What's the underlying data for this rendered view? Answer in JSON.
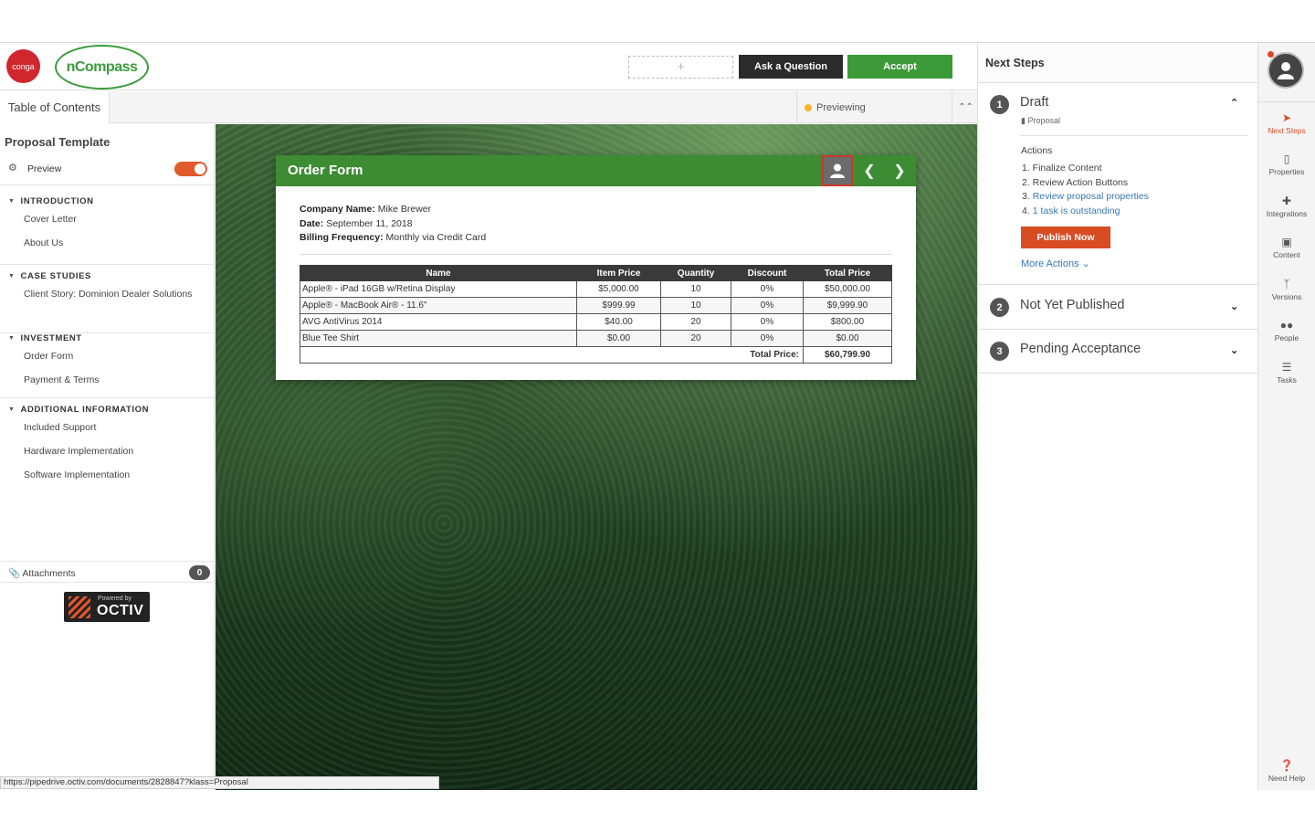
{
  "header": {
    "conga_logo": "conga",
    "ncompass_logo": "nCompass",
    "add_slot": "+",
    "ask_label": "Ask a Question",
    "accept_label": "Accept"
  },
  "subbar": {
    "toc_tab": "Table of Contents",
    "status": "Previewing",
    "status_color": "#f5b728"
  },
  "sidebar": {
    "title": "Proposal Template",
    "preview_label": "Preview",
    "preview_on": true,
    "sections": [
      {
        "title": "INTRODUCTION",
        "items": [
          "Cover Letter",
          "About Us"
        ]
      },
      {
        "title": "CASE STUDIES",
        "items": [
          "Client Story: Dominion Dealer Solutions"
        ]
      },
      {
        "title": "INVESTMENT",
        "items": [
          "Order Form",
          "Payment & Terms"
        ]
      },
      {
        "title": "ADDITIONAL INFORMATION",
        "items": [
          "Included Support",
          "Hardware Implementation",
          "Software Implementation"
        ]
      }
    ],
    "attachments_label": "Attachments",
    "attachments_count": "0",
    "powered_by": "Powered by",
    "octiv": "OCTIV"
  },
  "order_form": {
    "title": "Order Form",
    "company_label": "Company Name:",
    "company_value": "Mike Brewer",
    "date_label": "Date:",
    "date_value": "September 11, 2018",
    "billing_label": "Billing Frequency:",
    "billing_value": "Monthly via Credit Card",
    "columns": [
      "Name",
      "Item Price",
      "Quantity",
      "Discount",
      "Total Price"
    ],
    "rows": [
      [
        "Apple® - iPad 16GB w/Retina Display",
        "$5,000.00",
        "10",
        "0%",
        "$50,000.00"
      ],
      [
        "Apple® - MacBook Air® - 11.6\"",
        "$999.99",
        "10",
        "0%",
        "$9,999.90"
      ],
      [
        "AVG AntiVirus 2014",
        "$40.00",
        "20",
        "0%",
        "$800.00"
      ],
      [
        "Blue Tee Shirt",
        "$0.00",
        "20",
        "0%",
        "$0.00"
      ]
    ],
    "total_label": "Total Price:",
    "total_value": "$60,799.90"
  },
  "next_steps": {
    "header": "Next Steps",
    "step1": {
      "num": "1",
      "title": "Draft",
      "subtitle": "Proposal",
      "actions_label": "Actions",
      "actions": [
        "1. Finalize Content",
        "2. Review Action Buttons"
      ],
      "action_links": [
        "Review proposal properties",
        "1 task is outstanding"
      ],
      "action_link_nums": [
        "3.",
        "4."
      ],
      "publish_label": "Publish Now",
      "more_actions": "More Actions"
    },
    "step2": {
      "num": "2",
      "title": "Not Yet Published"
    },
    "step3": {
      "num": "3",
      "title": "Pending Acceptance"
    },
    "accent": "#d84c24"
  },
  "rail": {
    "items": [
      "Next Steps",
      "Properties",
      "Integrations",
      "Content",
      "Versions",
      "People",
      "Tasks"
    ],
    "help": "Need Help"
  },
  "status_url": "https://pipedrive.octiv.com/documents/2828847?klass=Proposal"
}
